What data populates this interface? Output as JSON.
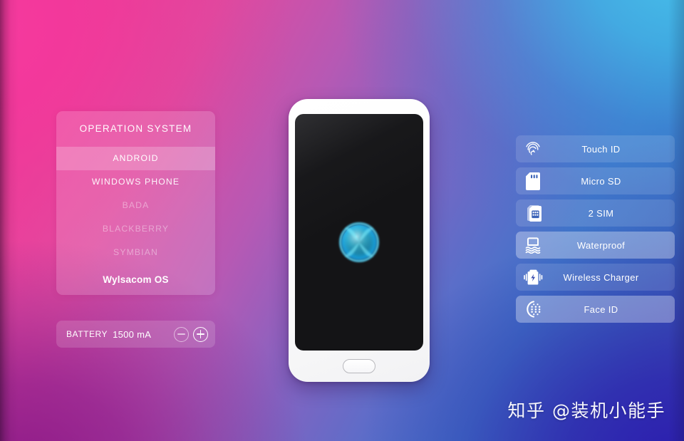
{
  "background": {
    "top_left_color": "#f1379a",
    "top_right_color": "#46c3eb",
    "bottom_left_color": "#8c1987",
    "bottom_right_color": "#2b1caf"
  },
  "os_panel": {
    "title": "OPERATION SYSTEM",
    "items": [
      {
        "label": "ANDROID",
        "state": "selected"
      },
      {
        "label": "WINDOWS PHONE",
        "state": "normal"
      },
      {
        "label": "BADA",
        "state": "dim"
      },
      {
        "label": "BLACKBERRY",
        "state": "dim"
      },
      {
        "label": "SYMBIAN",
        "state": "dim"
      },
      {
        "label": "Wylsacom OS",
        "state": "brand"
      }
    ]
  },
  "battery_panel": {
    "label": "BATTERY",
    "value": "1500 mA",
    "decrement_icon": "minus-circle-icon",
    "increment_icon": "plus-circle-icon"
  },
  "features": [
    {
      "label": "Touch ID",
      "icon": "fingerprint-icon",
      "state": "normal"
    },
    {
      "label": "Micro SD",
      "icon": "sd-card-icon",
      "state": "normal"
    },
    {
      "label": "2 SIM",
      "icon": "sim-card-icon",
      "state": "normal"
    },
    {
      "label": "Waterproof",
      "icon": "waterproof-icon",
      "state": "selected"
    },
    {
      "label": "Wireless Charger",
      "icon": "wireless-charger-icon",
      "state": "normal"
    },
    {
      "label": "Face ID",
      "icon": "face-id-icon",
      "state": "selected"
    }
  ],
  "phone": {
    "camera_icon": "front-camera-icon",
    "speaker_icon": "earpiece-speaker-icon",
    "wallpaper_icon": "blue-orb-icon",
    "home_button_icon": "home-button-icon"
  },
  "watermark": {
    "text": "知乎 @装机小能手"
  }
}
